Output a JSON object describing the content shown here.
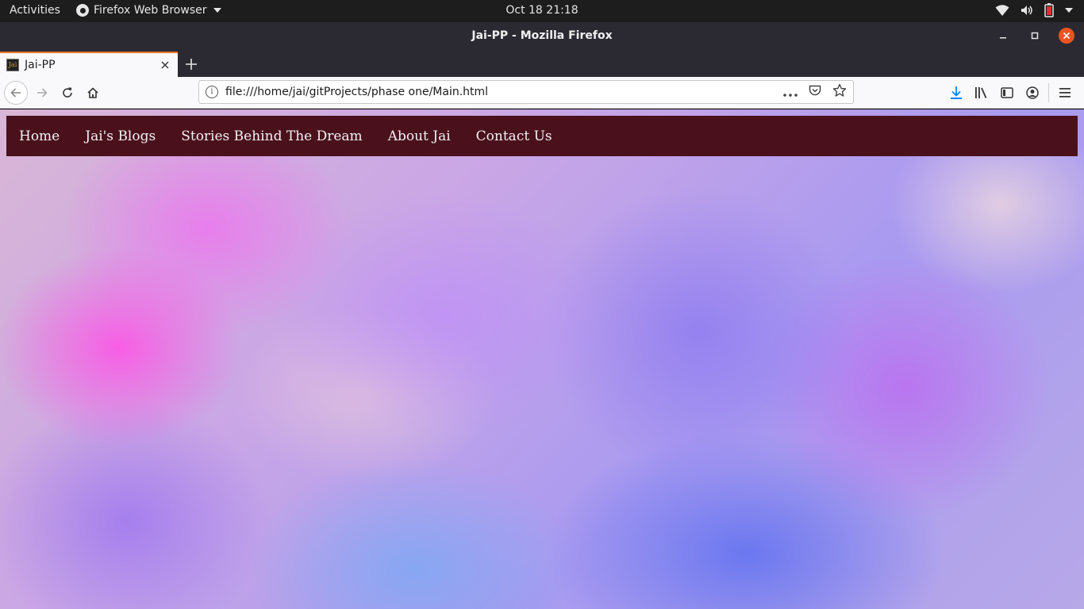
{
  "system_bar": {
    "activities": "Activities",
    "app_menu": "Firefox Web Browser",
    "clock": "Oct 18  21:18",
    "tray_icons": [
      "wifi-icon",
      "volume-icon",
      "battery-icon",
      "system-menu-caret-icon"
    ]
  },
  "window": {
    "title": "Jai-PP - Mozilla Firefox",
    "controls": [
      "minimize-icon",
      "maximize-icon",
      "close-icon"
    ]
  },
  "tabs": [
    {
      "title": "Jai-PP",
      "favicon_text": "Jai",
      "active": true
    }
  ],
  "toolbar": {
    "url": "file:///home/jai/gitProjects/phase one/Main.html",
    "nav_icons": [
      "back-icon",
      "forward-icon",
      "reload-icon",
      "home-icon"
    ],
    "url_icons": [
      "page-actions-icon",
      "pocket-icon",
      "bookmark-star-icon"
    ],
    "right_icons": [
      "downloads-icon",
      "library-icon",
      "sidebar-icon",
      "account-icon",
      "hamburger-menu-icon"
    ]
  },
  "site": {
    "nav": [
      {
        "label": "Home"
      },
      {
        "label": "Jai's Blogs"
      },
      {
        "label": "Stories Behind The Dream"
      },
      {
        "label": "About Jai"
      },
      {
        "label": "Contact Us"
      }
    ],
    "colors": {
      "nav_background": "#4a111c",
      "nav_text": "#f2f2f2"
    }
  },
  "colors": {
    "system_bar": "#1d1d1d",
    "titlebar": "#2b2a33",
    "close_button": "#e95420",
    "tab_accent": "#e9742a",
    "download_accent": "#0a84ff"
  }
}
